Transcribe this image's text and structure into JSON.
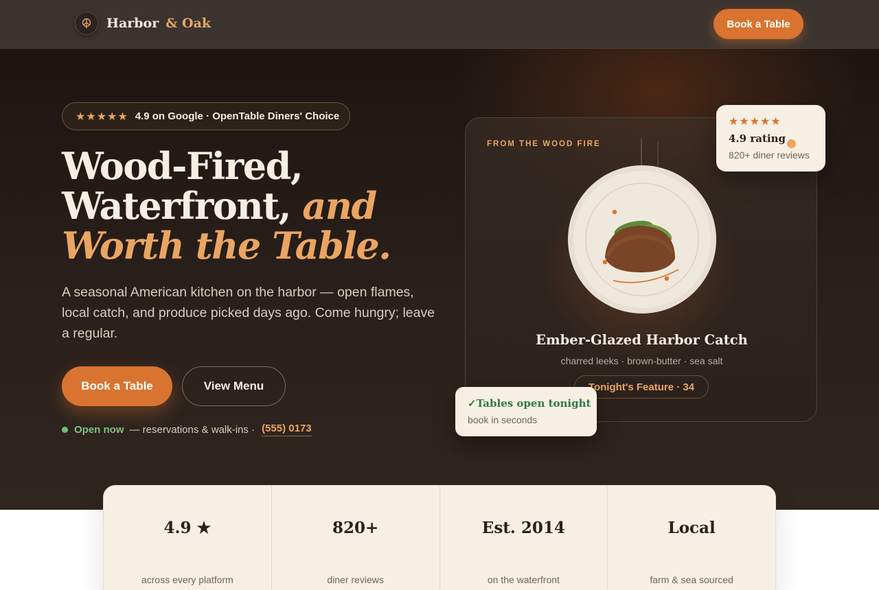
{
  "brand": {
    "name": "Harbor",
    "accent": "& Oak",
    "logo_icon": "leaf-icon"
  },
  "nav": {
    "cta_label": "Book a Table"
  },
  "hero": {
    "rating_stars": "★★★★★",
    "rating_text": "4.9 on Google · OpenTable Diners' Choice",
    "headline_line1": "Wood-Fired,",
    "headline_line2": "Waterfront,",
    "headline_accent1": "and",
    "headline_accent2": "Worth the Table.",
    "lede": "A seasonal American kitchen on the harbor — open flames, local catch, and produce picked days ago. Come hungry; leave a regular.",
    "primary_cta": "Book a Table",
    "secondary_cta": "View Menu",
    "status_open": "Open now",
    "status_rest": "— reservations & walk-ins ·",
    "phone": "(555) 0173"
  },
  "feature": {
    "eyebrow": "FROM THE WOOD FIRE",
    "dish_name": "Ember-Glazed Harbor Catch",
    "dish_desc": "charred leeks · brown-butter · sea salt",
    "tag": "Tonight's Feature · 34"
  },
  "rating_card": {
    "stars": "★★★★★",
    "value": "4.9 rating",
    "sub": "820+ diner reviews"
  },
  "tables_card": {
    "title": "✓Tables open tonight",
    "sub": "book in seconds"
  },
  "stats": [
    {
      "value": "4.9 ★",
      "label": "across every platform"
    },
    {
      "value": "820+",
      "label": "diner reviews"
    },
    {
      "value": "Est. 2014",
      "label": "on the waterfront"
    },
    {
      "value": "Local",
      "label": "farm & sea sourced"
    }
  ],
  "colors": {
    "accent": "#d97430",
    "accent_light": "#e9a661",
    "open_green": "#7cc47f",
    "dark_bg": "#1d1512",
    "cream": "#f6efe4"
  }
}
